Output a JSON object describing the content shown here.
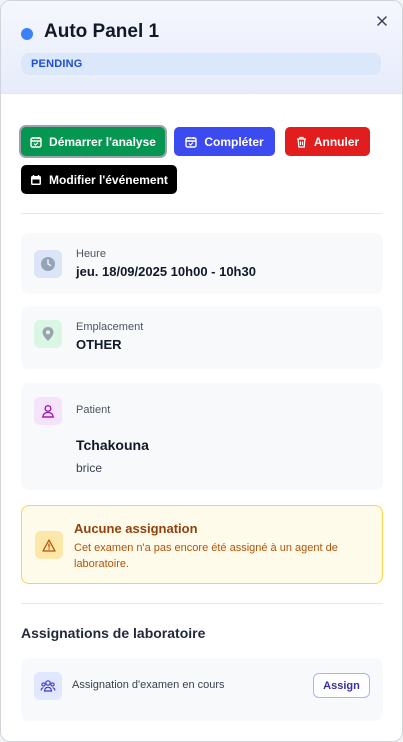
{
  "header": {
    "title": "Auto Panel 1",
    "status": "PENDING",
    "status_color": "#3b82f6"
  },
  "actions": {
    "start_label": "Démarrer l'analyse",
    "complete_label": "Compléter",
    "cancel_label": "Annuler",
    "edit_label": "Modifier l'événement"
  },
  "time": {
    "label": "Heure",
    "value": "jeu. 18/09/2025 10h00 - 10h30",
    "icon": "clock-icon"
  },
  "location": {
    "label": "Emplacement",
    "value": "OTHER",
    "icon": "map-pin-icon"
  },
  "patient": {
    "label": "Patient",
    "name": "Tchakouna",
    "first_name": "brice",
    "icon": "user-icon"
  },
  "alert": {
    "title": "Aucune assignation",
    "text": "Cet examen n'a pas encore été assigné à un agent de laboratoire.",
    "icon": "warning-icon"
  },
  "lab_assignments": {
    "title": "Assignations de laboratoire",
    "item_label": "Assignation d'examen en cours",
    "assign_label": "Assign",
    "icon": "users-icon"
  },
  "colors": {
    "start": "#059652",
    "complete": "#3b4bf0",
    "cancel": "#e11d1d",
    "edit": "#000000",
    "badge_bg": "#dbe7fb",
    "badge_text": "#1d4ed8",
    "alert_bg": "#fffbea",
    "alert_border": "#fcd34d"
  }
}
